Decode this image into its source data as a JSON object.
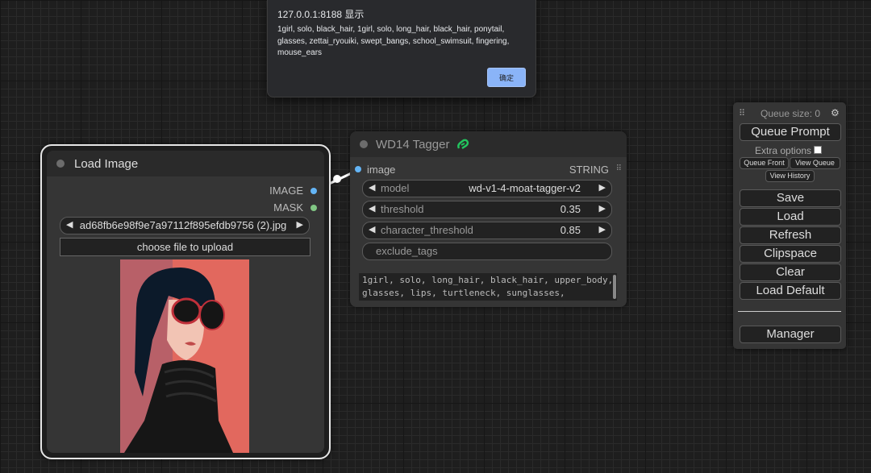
{
  "alert": {
    "title": "127.0.0.1:8188 显示",
    "message": "1girl, solo, black_hair, 1girl, solo, long_hair, black_hair, ponytail, glasses, zettai_ryouiki, swept_bangs, school_swimsuit, fingering, mouse_ears",
    "ok_label": "确定"
  },
  "load_image": {
    "title": "Load Image",
    "outputs": [
      {
        "label": "IMAGE",
        "color": "#64b5f6"
      },
      {
        "label": "MASK",
        "color": "#81c784"
      }
    ],
    "file_name": "ad68fb6e98f9e7a97112f895efdb9756 (2).jpg",
    "upload_label": "choose file to upload"
  },
  "tagger": {
    "title": "WD14 Tagger",
    "input_label": "image",
    "output_label": "STRING",
    "widgets": [
      {
        "label": "model",
        "value": "wd-v1-4-moat-tagger-v2"
      },
      {
        "label": "threshold",
        "value": "0.35"
      },
      {
        "label": "character_threshold",
        "value": "0.85"
      }
    ],
    "exclude_tags_placeholder": "exclude_tags",
    "output_text": "1girl, solo, long_hair, black_hair, upper_body,\nglasses, lips, turtleneck, sunglasses,"
  },
  "menu": {
    "queue_size": "Queue size: 0",
    "queue_prompt": "Queue Prompt",
    "extra_options": "Extra options",
    "queue_front": "Queue Front",
    "view_queue": "View Queue",
    "view_history": "View History",
    "save": "Save",
    "load": "Load",
    "refresh": "Refresh",
    "clipspace": "Clipspace",
    "clear": "Clear",
    "load_default": "Load Default",
    "manager": "Manager"
  },
  "colors": {
    "canvas": "#1e1e1e",
    "node_bg": "#353535",
    "image_slot": "#64b5f6",
    "mask_slot": "#81c784",
    "alert_button": "#8ab4f8",
    "tagger_icon": "#22c55e"
  }
}
